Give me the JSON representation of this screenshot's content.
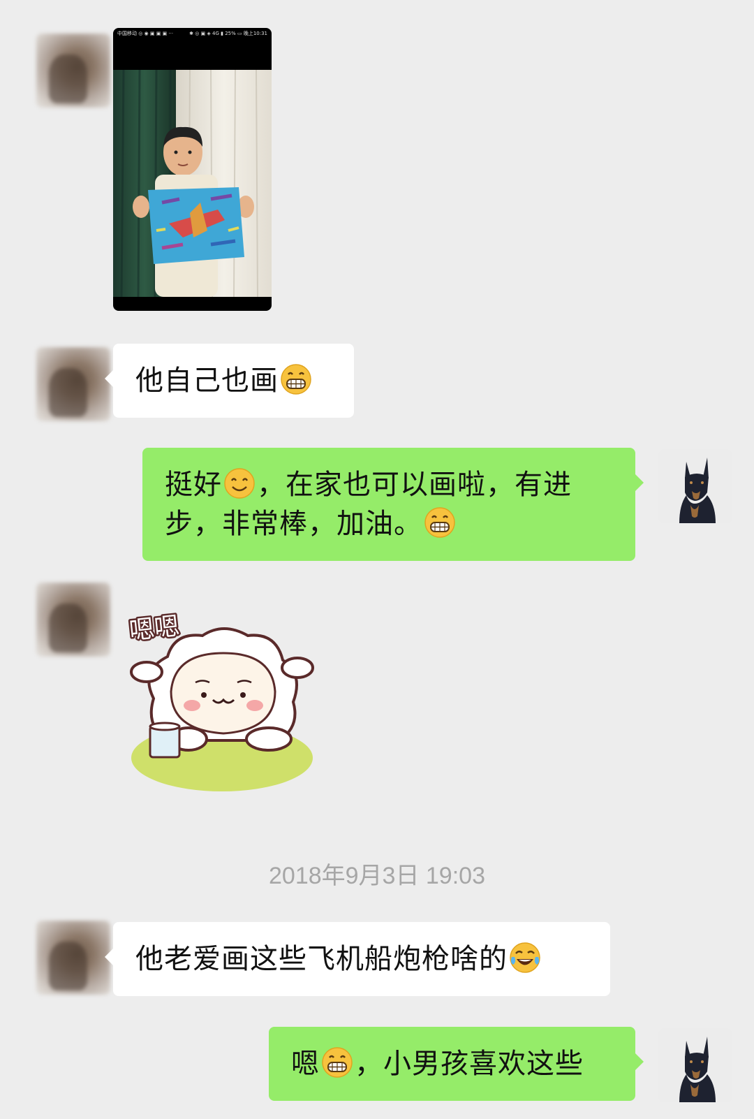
{
  "photo_message": {
    "status_bar_left": "中国移动 ◎ ◉ ▣ ▣ ▣ ···",
    "status_bar_right": "✱ ◎ ▣ ◈ 4G ▮ 25% ▭ 晚上10:31"
  },
  "messages": [
    {
      "side": "left",
      "text_before": "他自己也画",
      "emoji": "grin-emoji",
      "text_after": ""
    },
    {
      "side": "right",
      "line1_a": "挺好",
      "emoji1": "smile-emoji",
      "line1_b": "，在家也可以画啦，有进",
      "line2_a": "步，非常棒，加油。",
      "emoji2": "grin-emoji"
    },
    {
      "side": "left",
      "sticker_text": "嗯嗯"
    },
    {
      "side": "left",
      "text_before": "他老爱画这些飞机船炮枪啥的",
      "emoji": "tears-of-joy-emoji"
    },
    {
      "side": "right",
      "text_before": "嗯",
      "emoji": "grin-emoji",
      "text_after": "，小男孩喜欢这些"
    }
  ],
  "timestamp": "2018年9月3日 19:03",
  "colors": {
    "background": "#ededed",
    "bubble_left": "#ffffff",
    "bubble_right": "#95ec69",
    "timestamp": "#a6a6a6"
  }
}
